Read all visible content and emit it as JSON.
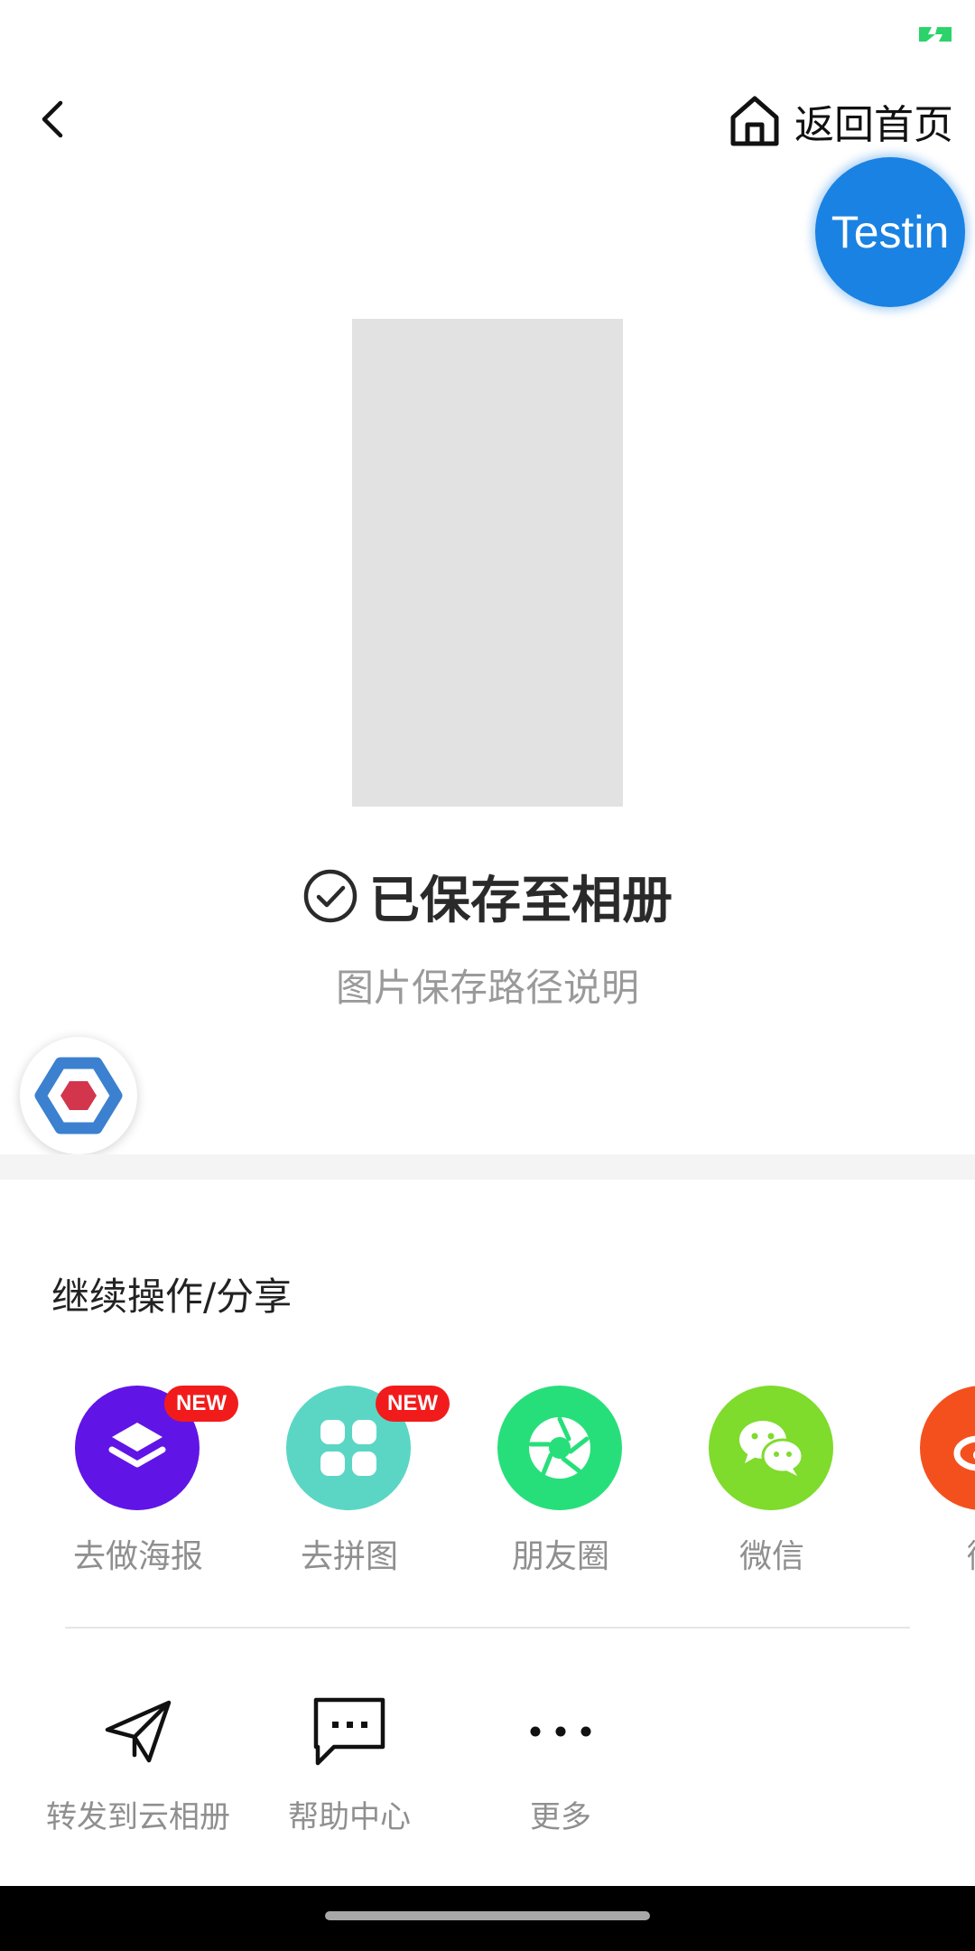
{
  "status_bar": {
    "battery_icon": "battery-charging-icon",
    "battery_color": "#2bd36a"
  },
  "header": {
    "back_icon": "chevron-left-icon",
    "home_icon": "home-icon",
    "home_label": "返回首页"
  },
  "testin_badge": {
    "label": "Testin",
    "color": "#1a82e2"
  },
  "saved": {
    "icon": "check-circle-icon",
    "title": "已保存至相册",
    "subtitle": "图片保存路径说明"
  },
  "float_logo": {
    "icon": "hexagon-logo-icon"
  },
  "share": {
    "title": "继续操作/分享",
    "items": [
      {
        "label": "去做海报",
        "icon": "layers-icon",
        "color": "#6015e6",
        "badge": "NEW"
      },
      {
        "label": "去拼图",
        "icon": "grid-icon",
        "color": "#5bd6c4",
        "badge": "NEW"
      },
      {
        "label": "朋友圈",
        "icon": "aperture-icon",
        "color": "#27df7a"
      },
      {
        "label": "微信",
        "icon": "wechat-icon",
        "color": "#7fdb2c"
      },
      {
        "label": "微",
        "icon": "weibo-icon",
        "color": "#f4501e"
      }
    ]
  },
  "actions": {
    "items": [
      {
        "label": "转发到云相册",
        "icon": "paper-plane-icon"
      },
      {
        "label": "帮助中心",
        "icon": "chat-bubble-icon"
      },
      {
        "label": "更多",
        "icon": "more-dots-icon"
      }
    ]
  }
}
